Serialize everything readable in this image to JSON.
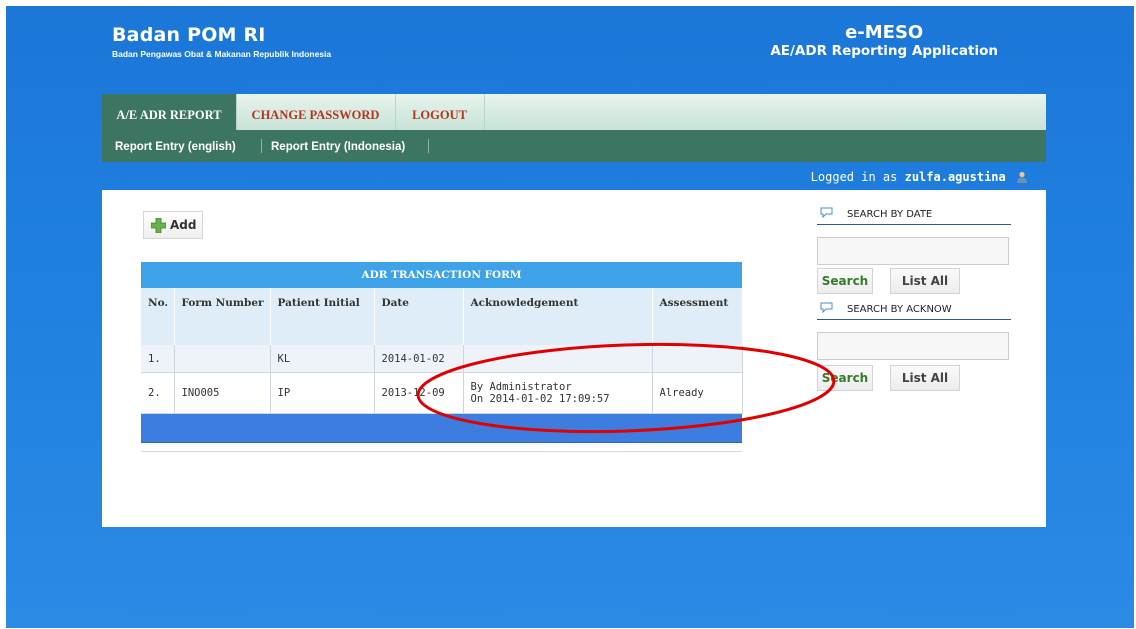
{
  "header": {
    "brand_title": "Badan POM RI",
    "brand_subtitle": "Badan Pengawas Obat & Makanan Republik Indonesia",
    "app_title": "e-MESO",
    "app_subtitle": "AE/ADR Reporting Application"
  },
  "tabs": [
    {
      "label": "A/E ADR REPORT",
      "active": true
    },
    {
      "label": "CHANGE PASSWORD",
      "active": false
    },
    {
      "label": "LOGOUT",
      "active": false
    }
  ],
  "subnav": [
    {
      "label": "Report Entry (english)"
    },
    {
      "label": "Report Entry (Indonesia)"
    }
  ],
  "login": {
    "prefix": "Logged in as",
    "username": "zulfa.agustina",
    "icon": "user-icon"
  },
  "add_button": {
    "label": "Add",
    "icon": "add-icon"
  },
  "table": {
    "title": "ADR TRANSACTION FORM",
    "columns": [
      "No.",
      "Form Number",
      "Patient Initial",
      "Date",
      "Acknowledgement",
      "Assessment"
    ],
    "rows": [
      {
        "no": "1.",
        "form_number": "",
        "patient_initial": "KL",
        "date": "2014-01-02",
        "ack_line1": "",
        "ack_line2": "",
        "assessment": ""
      },
      {
        "no": "2.",
        "form_number": "INO005",
        "patient_initial": "IP",
        "date": "2013-12-09",
        "ack_line1": "By Administrator",
        "ack_line2": "On 2014-01-02 17:09:57",
        "assessment": "Already"
      }
    ]
  },
  "search_by_date": {
    "label": "SEARCH BY DATE",
    "value": "",
    "search_label": "Search",
    "list_label": "List All"
  },
  "search_by_ack": {
    "label": "SEARCH BY ACKNOW",
    "value": "",
    "search_label": "Search",
    "list_label": "List All"
  },
  "colors": {
    "background_blue": "#1f7fdf",
    "nav_green": "#3d7563",
    "tab_text_red": "#b2361a",
    "table_header_blue": "#3da2e7",
    "annotation_red": "#e10000"
  }
}
